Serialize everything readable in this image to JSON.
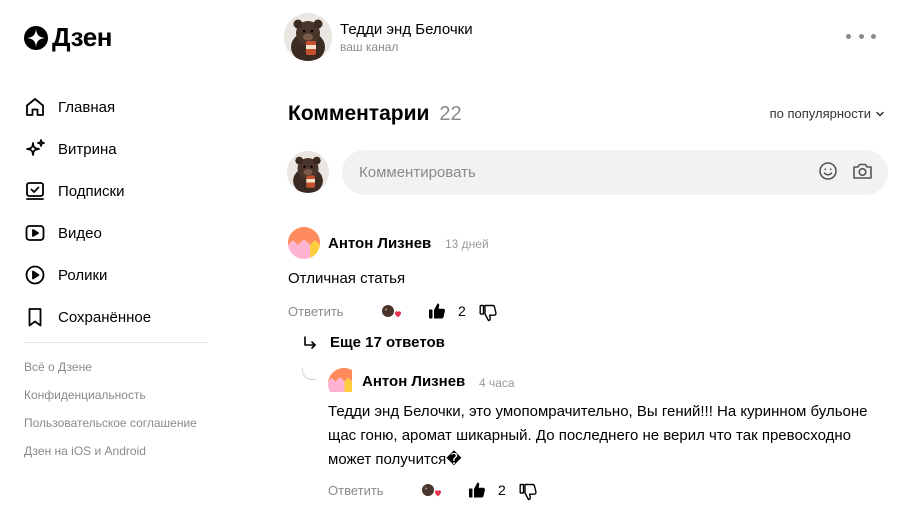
{
  "app": {
    "name": "Дзен"
  },
  "sidebar": {
    "items": [
      {
        "label": "Главная",
        "icon": "home-icon"
      },
      {
        "label": "Витрина",
        "icon": "sparkle-icon"
      },
      {
        "label": "Подписки",
        "icon": "subscriptions-icon"
      },
      {
        "label": "Видео",
        "icon": "video-icon"
      },
      {
        "label": "Ролики",
        "icon": "clips-icon"
      },
      {
        "label": "Сохранённое",
        "icon": "bookmark-icon"
      }
    ],
    "footer_links": [
      "Всё о Дзене",
      "Конфиденциальность",
      "Пользовательское соглашение",
      "Дзен на iOS и Android"
    ]
  },
  "channel": {
    "name": "Тедди энд Белочки",
    "subtitle": "ваш канал"
  },
  "comments": {
    "title": "Комментарии",
    "count": "22",
    "sort_label": "по популярности",
    "input_placeholder": "Комментировать",
    "items": [
      {
        "author": "Антон Лизнев",
        "time": "13 дней",
        "text": "Отличная статья",
        "reply_label": "Ответить",
        "likes": "2"
      }
    ],
    "more_replies_label": "Еще 17 ответов",
    "reply": {
      "author": "Антон Лизнев",
      "time": "4 часа",
      "text": "Тедди энд Белочки, это умопомрачительно, Вы гений!!! На куринном бульоне щас гоню, аромат шикарный. До последнего не верил что так превосходно может получится�",
      "reply_label": "Ответить",
      "likes": "2"
    }
  },
  "colors": {
    "accent_heart": "#e8304b",
    "muted": "#8a8a8a",
    "input_bg": "#f2f2f2"
  }
}
